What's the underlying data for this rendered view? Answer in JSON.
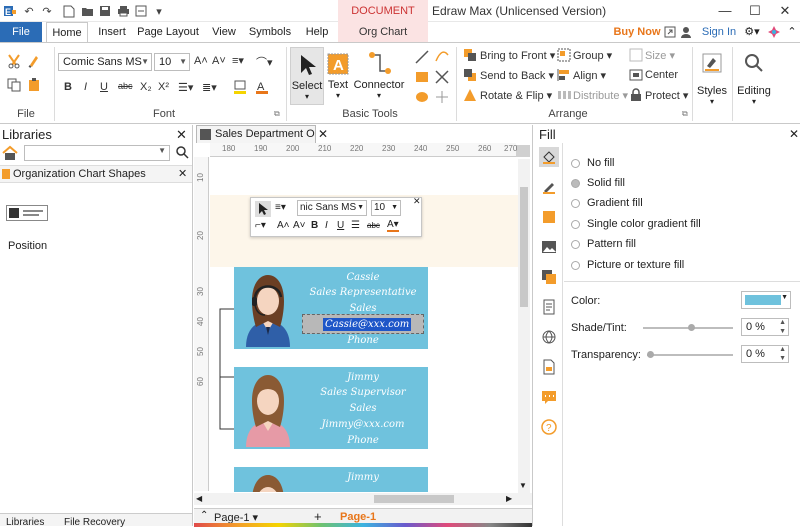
{
  "titlebar": {
    "contextual_tab": "DOCUMENT TO...",
    "app_title": "Edraw Max (Unlicensed Version)"
  },
  "tabs": [
    {
      "id": "file",
      "label": "File"
    },
    {
      "id": "home",
      "label": "Home"
    },
    {
      "id": "insert",
      "label": "Insert"
    },
    {
      "id": "page_layout",
      "label": "Page Layout"
    },
    {
      "id": "view",
      "label": "View"
    },
    {
      "id": "symbols",
      "label": "Symbols"
    },
    {
      "id": "help",
      "label": "Help"
    },
    {
      "id": "org_chart",
      "label": "Org Chart"
    }
  ],
  "account": {
    "buy_now": "Buy Now",
    "sign_in": "Sign In"
  },
  "ribbon": {
    "file_group": "File",
    "font_group": "Font",
    "font_name": "Comic Sans MS",
    "font_size": "10",
    "basic_tools_group": "Basic Tools",
    "select": "Select",
    "text": "Text",
    "connector": "Connector",
    "arrange_group": "Arrange",
    "bring_to_front": "Bring to Front",
    "send_to_back": "Send to Back",
    "rotate_flip": "Rotate & Flip",
    "group": "Group",
    "align": "Align",
    "distribute": "Distribute",
    "size": "Size",
    "center": "Center",
    "protect": "Protect",
    "styles": "Styles",
    "editing": "Editing"
  },
  "libraries": {
    "title": "Libraries",
    "search_placeholder": "",
    "category": "Organization Chart Shapes",
    "shape_label": "Position",
    "bottom_tabs": [
      "Libraries",
      "File Recovery"
    ]
  },
  "document": {
    "tab_title": "Sales Department O...",
    "ruler_h": [
      "180",
      "190",
      "200",
      "210",
      "220",
      "230",
      "240",
      "250",
      "260",
      "270"
    ],
    "ruler_v": [
      "10",
      "20",
      "30",
      "40",
      "50",
      "60"
    ],
    "mini_toolbar": {
      "font": "nic Sans MS",
      "size": "10"
    },
    "cards": [
      {
        "name": "Cassie",
        "title": "Sales Representative",
        "dept": "Sales",
        "email": "Cassie@xxx.com",
        "phone": "Phone",
        "gender": "female-headset"
      },
      {
        "name": "Jimmy",
        "title": "Sales Supervisor",
        "dept": "Sales",
        "email": "Jimmy@xxx.com",
        "phone": "Phone",
        "gender": "female"
      },
      {
        "name": "Jimmy",
        "title": "",
        "dept": "",
        "email": "",
        "phone": "",
        "gender": "female"
      }
    ],
    "pages": {
      "current": "Page-1",
      "active": "Page-1"
    }
  },
  "fill": {
    "title": "Fill",
    "options": [
      {
        "label": "No fill",
        "selected": false
      },
      {
        "label": "Solid fill",
        "selected": true
      },
      {
        "label": "Gradient fill",
        "selected": false
      },
      {
        "label": "Single color gradient fill",
        "selected": false
      },
      {
        "label": "Pattern fill",
        "selected": false
      },
      {
        "label": "Picture or texture fill",
        "selected": false
      }
    ],
    "color_label": "Color:",
    "color_value": "#6fc2dd",
    "shade_label": "Shade/Tint:",
    "shade_value": "0 %",
    "shade_level": 0.5,
    "transparency_label": "Transparency:",
    "transparency_value": "0 %",
    "transparency_level": 0
  },
  "colors": {
    "accent_blue": "#2b6cb6",
    "card": "#6fc2dd",
    "orange": "#f39c2b",
    "buy_now": "#e8761a"
  }
}
